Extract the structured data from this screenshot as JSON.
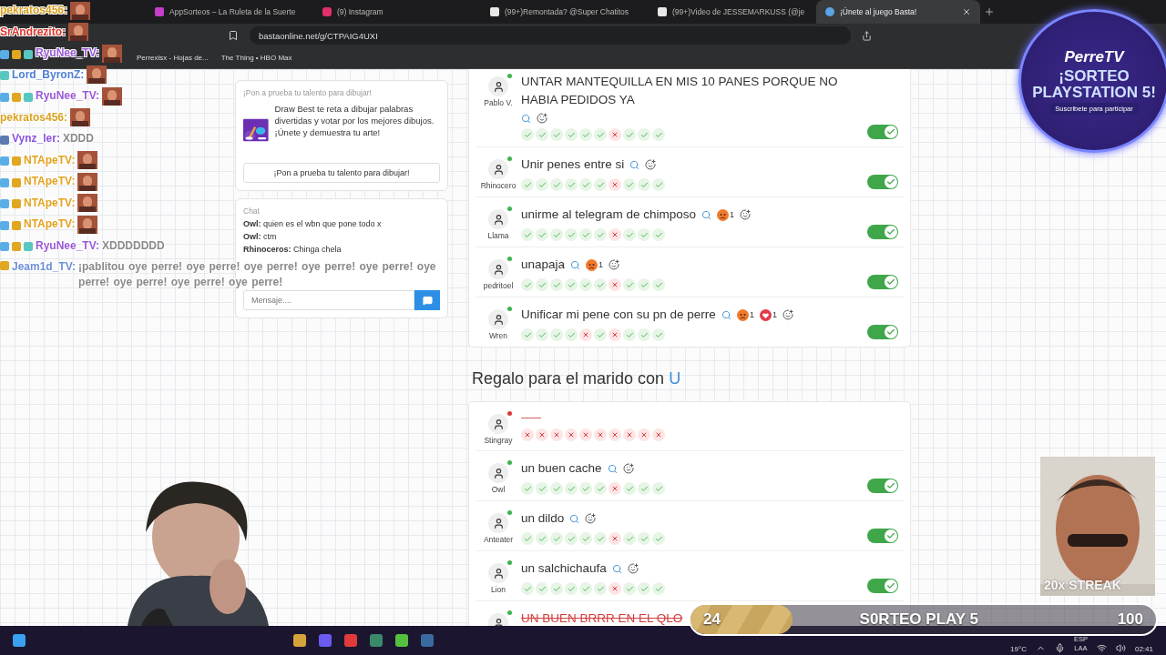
{
  "browser": {
    "tabs": [
      {
        "title": "AppSorteos – La Ruleta de la Suerte",
        "selected": false
      },
      {
        "title": "(9) Instagram",
        "selected": false
      },
      {
        "title": "(99+)Remontada? @Super Chatitos",
        "selected": false
      },
      {
        "title": "(99+)Video de JESSEMARKUSS (@je",
        "selected": false
      },
      {
        "title": "¡Únete al juego Basta!",
        "selected": true
      }
    ],
    "url": "bastaonline.net/g/CTPAIG4UXI",
    "bookmarks": [
      {
        "label": "Perrexlsx - Hojas de..."
      },
      {
        "label": "The Thing • HBO Max"
      }
    ]
  },
  "stream_chat": [
    {
      "user": "pekratos456:",
      "color": "#d9a11e",
      "emote": true
    },
    {
      "user": "SrAndrezito:",
      "color": "#e0352b",
      "emote": true
    },
    {
      "user": "RyuNee_TV:",
      "color": "#9a5ad6",
      "badges": [
        {
          "kind": "sword"
        },
        {
          "kind": "crown"
        },
        {
          "kind": "gift"
        }
      ],
      "emote": true
    },
    {
      "user": "Lord_ByronZ:",
      "color": "#4f7fd6",
      "badges": [
        {
          "kind": "gift"
        }
      ],
      "emote": true
    },
    {
      "user": "RyuNee_TV:",
      "color": "#9a5ad6",
      "badges": [
        {
          "kind": "sword"
        },
        {
          "kind": "crown"
        },
        {
          "kind": "gift"
        }
      ],
      "emote": true
    },
    {
      "user": "pekratos456:",
      "color": "#d9a11e",
      "emote": true
    },
    {
      "user": "Vynz_ler:",
      "color": "#8a52e0",
      "badges": [
        {
          "kind": "eye"
        }
      ],
      "text": "XDDD",
      "emote": false
    },
    {
      "user": "NTApeTV:",
      "color": "#e3a21f",
      "badges": [
        {
          "kind": "sword"
        },
        {
          "kind": "crown"
        }
      ],
      "emote": true
    },
    {
      "user": "NTApeTV:",
      "color": "#e3a21f",
      "badges": [
        {
          "kind": "sword"
        },
        {
          "kind": "crown"
        }
      ],
      "emote": true
    },
    {
      "user": "NTApeTV:",
      "color": "#e3a21f",
      "badges": [
        {
          "kind": "sword"
        },
        {
          "kind": "crown"
        }
      ],
      "emote": true
    },
    {
      "user": "NTApeTV:",
      "color": "#e3a21f",
      "badges": [
        {
          "kind": "sword"
        },
        {
          "kind": "crown"
        }
      ],
      "emote": true
    },
    {
      "user": "RyuNee_TV:",
      "color": "#9a5ad6",
      "badges": [
        {
          "kind": "sword"
        },
        {
          "kind": "crown"
        },
        {
          "kind": "gift"
        }
      ],
      "text": "XDDDDDDD",
      "emote": false
    },
    {
      "user": "Jeam1d_TV:",
      "color": "#6f8fd6",
      "badges": [
        {
          "kind": "crown"
        }
      ],
      "text": "¡pablitou oye perre! oye perre! oye perre! oye perre! oye perre! oye perre! oye perre! oye perre! oye perre!",
      "emote": false
    }
  ],
  "sidebar": {
    "ad": {
      "heading": "¡Pon a prueba tu talento para dibujar!",
      "description": "Draw Best te reta a dibujar palabras divertidas y votar por los mejores dibujos. ¡Únete y demuestra tu arte!",
      "button": "¡Pon a prueba tu talento para dibujar!"
    },
    "chat": {
      "title": "Chat",
      "messages": [
        {
          "user": "Owl:",
          "text": "quien es el wbn que pone todo x"
        },
        {
          "user": "Owl:",
          "text": "ctm"
        },
        {
          "user": "Rhinoceros:",
          "text": "Chinga chela"
        }
      ],
      "placeholder": "Mensaje...."
    }
  },
  "categories": [
    {
      "answers": [
        {
          "player": "Pablo V.",
          "online": true,
          "kind": "answer",
          "answer": "UNTAR MANTEQUILLA EN MIS 10 PANES PORQUE NO HABIA PEDIDOS YA",
          "struck": false,
          "votes": [
            true,
            true,
            true,
            true,
            true,
            true,
            false,
            true,
            true,
            true
          ],
          "accepted": true
        },
        {
          "player": "Rhinocero",
          "online": true,
          "kind": "answer",
          "answer": "Unir penes entre si",
          "struck": false,
          "votes": [
            true,
            true,
            true,
            true,
            true,
            true,
            false,
            true,
            true,
            true
          ],
          "accepted": true
        },
        {
          "player": "Llama",
          "online": true,
          "kind": "answer",
          "answer": "unirme al telegram de chimposo",
          "struck": false,
          "reactions": [
            {
              "kind": "angry",
              "count": "1"
            }
          ],
          "votes": [
            true,
            true,
            true,
            true,
            true,
            true,
            false,
            true,
            true,
            true
          ],
          "accepted": true
        },
        {
          "player": "pedritoel",
          "online": true,
          "kind": "answer",
          "answer": "unapaja",
          "struck": false,
          "reactions": [
            {
              "kind": "angry",
              "count": "1"
            }
          ],
          "votes": [
            true,
            true,
            true,
            true,
            true,
            true,
            false,
            true,
            true,
            true
          ],
          "accepted": true
        },
        {
          "player": "Wren",
          "online": true,
          "kind": "answer",
          "answer": "Unificar mi pene con su pn de perre",
          "struck": false,
          "reactions": [
            {
              "kind": "angry",
              "count": "1"
            },
            {
              "kind": "heart",
              "count": "1"
            }
          ],
          "votes": [
            true,
            true,
            true,
            true,
            false,
            true,
            false,
            true,
            true,
            true
          ],
          "accepted": true
        }
      ]
    },
    {
      "title": "Regalo para el marido con",
      "letter": "U",
      "answers": [
        {
          "player": "Stingray",
          "online": false,
          "kind": "blank",
          "votes": [
            false,
            false,
            false,
            false,
            false,
            false,
            false,
            false,
            false,
            false
          ],
          "accepted": false
        },
        {
          "player": "Owl",
          "online": true,
          "kind": "answer",
          "answer": "un buen cache",
          "struck": false,
          "votes": [
            true,
            true,
            true,
            true,
            true,
            true,
            false,
            true,
            true,
            true
          ],
          "accepted": true
        },
        {
          "player": "Anteater",
          "online": true,
          "kind": "answer",
          "answer": "un dildo",
          "struck": false,
          "votes": [
            true,
            true,
            true,
            true,
            true,
            true,
            false,
            true,
            true,
            true
          ],
          "accepted": true
        },
        {
          "player": "Lion",
          "online": true,
          "kind": "answer",
          "answer": "un salchichaufa",
          "struck": false,
          "votes": [
            true,
            true,
            true,
            true,
            true,
            true,
            false,
            true,
            true,
            true
          ],
          "accepted": true
        },
        {
          "online": true,
          "kind": "answer",
          "answer": "UN BUEN BRRR EN EL QLO",
          "struck": true,
          "accepted": false
        }
      ]
    }
  ],
  "overlay": {
    "badge": {
      "brand": "PerreTV",
      "headline": "¡SORTEO PLAYSTATION 5!",
      "subtitle": "Suscribete para participar"
    },
    "streak": {
      "label": "20x STREAK"
    },
    "goal": {
      "current": "24",
      "title": "S0RTEO PLAY 5",
      "target": "100",
      "level": 0.22
    }
  },
  "taskbar": {
    "temperature": "19°C",
    "language": "ESP",
    "layout": "LAA",
    "time": "02:41"
  }
}
